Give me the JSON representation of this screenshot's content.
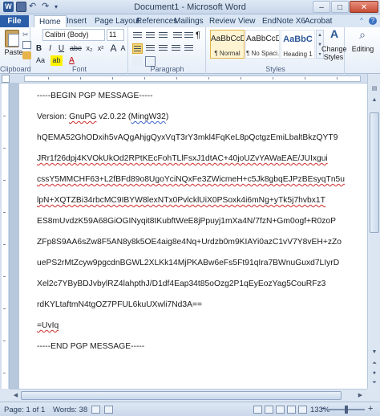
{
  "window": {
    "title": "Document1 - Microsoft Word",
    "controls": [
      "–",
      "□",
      "✕"
    ]
  },
  "tabs": [
    "File",
    "Home",
    "Insert",
    "Page Layout",
    "References",
    "Mailings",
    "Review",
    "View",
    "EndNote X6",
    "Acrobat"
  ],
  "active_tab": "Home",
  "ribbon": {
    "clipboard": {
      "paste_label": "Paste",
      "group_label": "Clipboard"
    },
    "font": {
      "font_name": "Calibri (Body)",
      "font_size": "11",
      "bold": "B",
      "italic": "I",
      "underline": "U",
      "strike": "abe",
      "subscript": "x₂",
      "superscript": "x²",
      "grow": "A",
      "shrink": "A",
      "change_case": "Aa",
      "highlight": "ab",
      "font_color": "A",
      "group_label": "Font"
    },
    "paragraph": {
      "group_label": "Paragraph"
    },
    "styles": {
      "items": [
        {
          "sample": "AaBbCcDc",
          "name": "¶ Normal",
          "selected": true
        },
        {
          "sample": "AaBbCcDc",
          "name": "¶ No Spaci...",
          "selected": false
        },
        {
          "sample": "AaBbC",
          "name": "Heading 1",
          "selected": false
        }
      ],
      "change_styles": "Change Styles",
      "group_label": "Styles"
    },
    "editing": {
      "label": "Editing"
    }
  },
  "document": {
    "lines": [
      {
        "text": "-----BEGIN PGP MESSAGE-----"
      },
      {
        "text": "Version: GnuPG v2.0.22 (MingW32)"
      },
      {
        "text": ""
      },
      {
        "text": "hQEMA52GhODxih5vAQgAhjgQyxVqT3rY3mkl4FqKeL8pQctgzEmiLbaltBkzQYT9"
      },
      {
        "text": "JRr1f26dpj4KVOkUkOd2RPtKEcFohTLlFsxJ1dtAC+40joUZvYAWaEAE/JUIxgui"
      },
      {
        "text": "cssY5MMCHF63+L2fBFd89o8UgoYciNQxFe3ZWicmeH+c5Jk8gbqEJPzBEsyqTn5u"
      },
      {
        "text": "lpN+XQTZBi34rbcMC9IBYW8lexNTx0PvlcklUiX0PSoxk4i6mNg+yTk5j7hvbx1T"
      },
      {
        "text": "ES8mUvdzK59A68GiOGINyqit8tKubftWeE8jPpuyj1mXa4N/7fzN+Gm0ogf+R0zoP"
      },
      {
        "text": "ZFp8S9AA6sZw8F5AN8y8k5OE4aig8e4Nq+Urdzb0m9KIAYi0azC1vV7Y8vEH+zZo"
      },
      {
        "text": "uePS2rMtZcyw9pgcdnBGWL2XLKk14MjPKABw6eFs5Ft91qIra7BWnuGuxd7LIyrD"
      },
      {
        "text": "Xel2c7YByBDJvbylRZ4lahpthJ/D1df4Eap34t85oOzg2P1qEyEozYag5CouRFz3"
      },
      {
        "text": "rdKYLtaftmN4tgOZ7PFUL6kuUXwli7Nd3A=="
      },
      {
        "text": "=UvIq"
      },
      {
        "text": "-----END PGP MESSAGE-----"
      }
    ]
  },
  "statusbar": {
    "page": "Page: 1 of 1",
    "words": "Words: 38",
    "zoom": "133%"
  }
}
